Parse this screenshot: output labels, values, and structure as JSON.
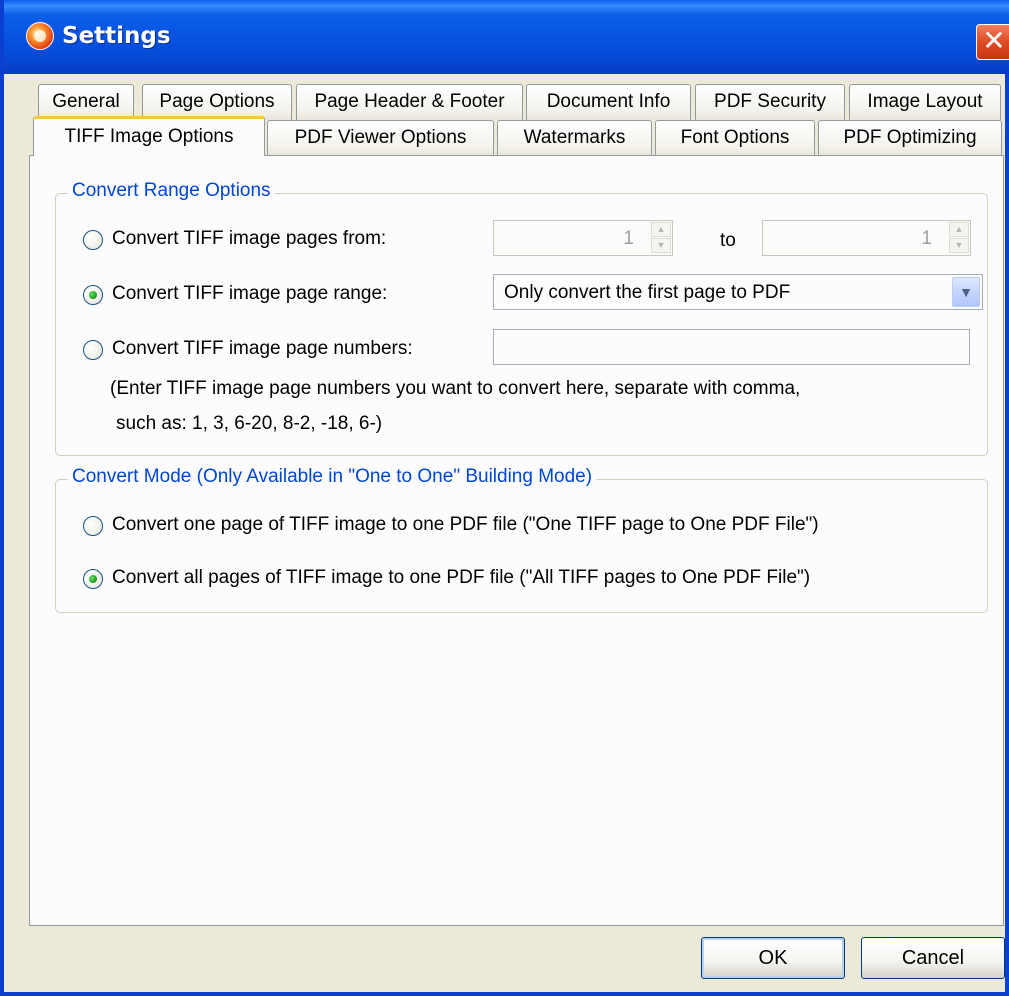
{
  "window": {
    "title": "Settings",
    "close_label": "✕",
    "icon": "app-logo-icon"
  },
  "tabs": {
    "row1": [
      "General",
      "Page Options",
      "Page Header & Footer",
      "Document Info",
      "PDF Security",
      "Image Layout"
    ],
    "row2": [
      "TIFF Image Options",
      "PDF Viewer Options",
      "Watermarks",
      "Font Options",
      "PDF Optimizing"
    ],
    "active": "TIFF Image Options"
  },
  "convert_range": {
    "legend": "Convert Range Options",
    "option_pages_from": {
      "label": "Convert TIFF image pages from:",
      "from_value": "1",
      "to_label": "to",
      "to_value": "1",
      "checked": false
    },
    "option_page_range": {
      "label": "Convert TIFF image page range:",
      "selected": "Only convert the first page to PDF",
      "checked": true
    },
    "option_page_numbers": {
      "label": "Convert TIFF image page numbers:",
      "value": "",
      "checked": false
    },
    "hint_line1": "(Enter TIFF image page numbers you want to convert here, separate with comma,",
    "hint_line2": "such as: 1, 3, 6-20, 8-2, -18, 6-)"
  },
  "convert_mode": {
    "legend": "Convert Mode (Only Available in \"One to One\" Building Mode)",
    "option_one_page": {
      "label": "Convert one page of TIFF image to one PDF file (\"One TIFF page to One PDF File\")",
      "checked": false
    },
    "option_all_pages": {
      "label": "Convert all pages of TIFF image to one PDF file (\"All TIFF pages to One PDF File\")",
      "checked": true
    }
  },
  "buttons": {
    "ok": "OK",
    "cancel": "Cancel"
  },
  "colors": {
    "titlebar": "#0650df",
    "legend_text": "#0046d5",
    "active_tab_accent": "#ffc83c",
    "radio_dot": "#21a121"
  }
}
